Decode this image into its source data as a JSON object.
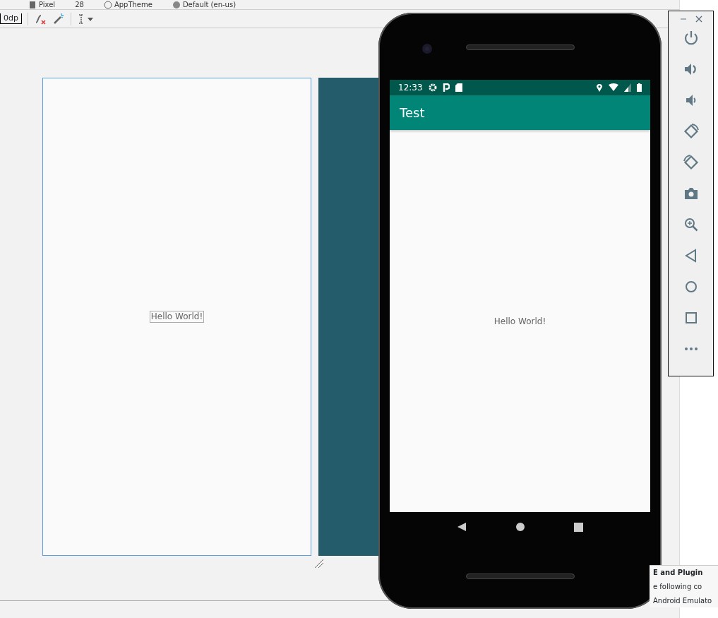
{
  "top_toolbar": {
    "items": [
      {
        "kind": "device",
        "label": "Pixel"
      },
      {
        "kind": "api",
        "label": "28"
      },
      {
        "kind": "theme",
        "label": "AppTheme"
      },
      {
        "kind": "locale",
        "label": "Default (en-us)"
      }
    ]
  },
  "design_toolbar": {
    "margin_value": "0dp"
  },
  "blueprint": {
    "preview_text": "Hello World!"
  },
  "emulator": {
    "time": "12:33",
    "app_title": "Test",
    "content_text": "Hello World!"
  },
  "notification": {
    "title": "E and Plugin",
    "lines": [
      "e following co",
      "Android Emulato"
    ]
  }
}
